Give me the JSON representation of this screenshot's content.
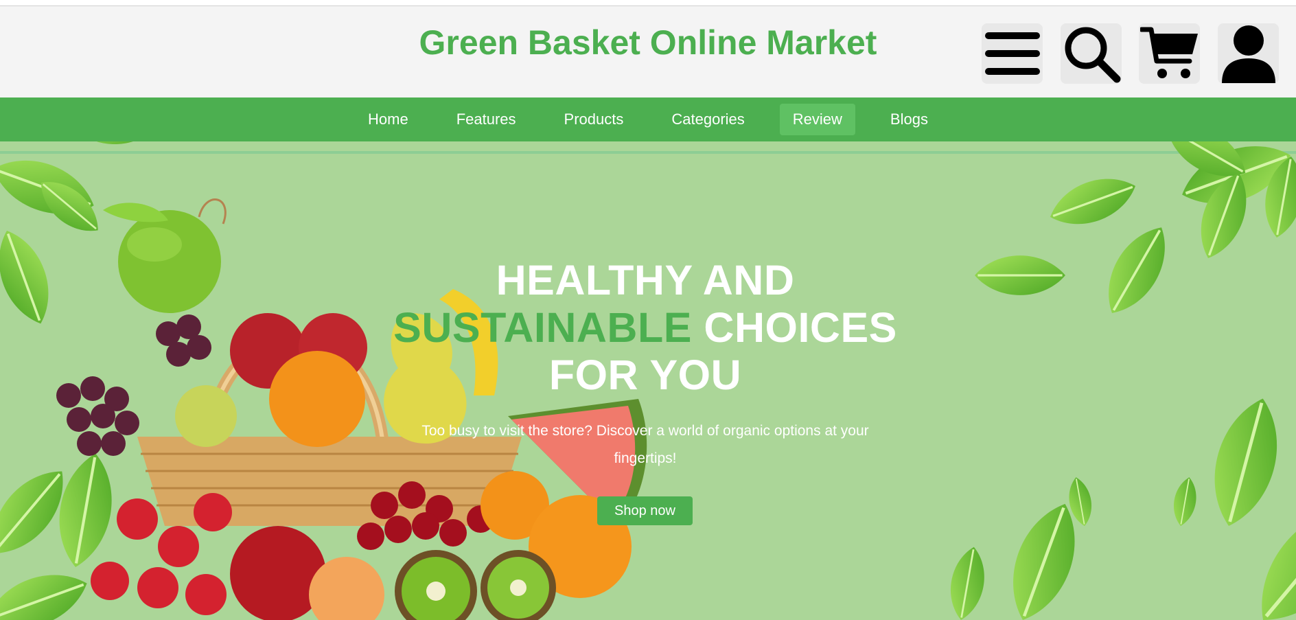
{
  "header": {
    "title": "Green Basket Online Market",
    "icons": {
      "menu": "menu-icon",
      "search": "search-icon",
      "cart": "cart-icon",
      "user": "user-icon"
    }
  },
  "nav": {
    "items": [
      {
        "label": "Home",
        "active": false
      },
      {
        "label": "Features",
        "active": false
      },
      {
        "label": "Products",
        "active": false
      },
      {
        "label": "Categories",
        "active": false
      },
      {
        "label": "Review",
        "active": true
      },
      {
        "label": "Blogs",
        "active": false
      }
    ]
  },
  "hero": {
    "heading_line1": "HEALTHY AND",
    "heading_accent": "SUSTAINABLE",
    "heading_line2_rest": " CHOICES",
    "heading_line3": "FOR YOU",
    "subtext": "Too busy to visit the store? Discover a world of organic options at your fingertips!",
    "cta_label": "Shop now"
  },
  "colors": {
    "brand_green": "#4caf50",
    "hero_background": "#abd698",
    "header_background": "#f4f4f4"
  }
}
